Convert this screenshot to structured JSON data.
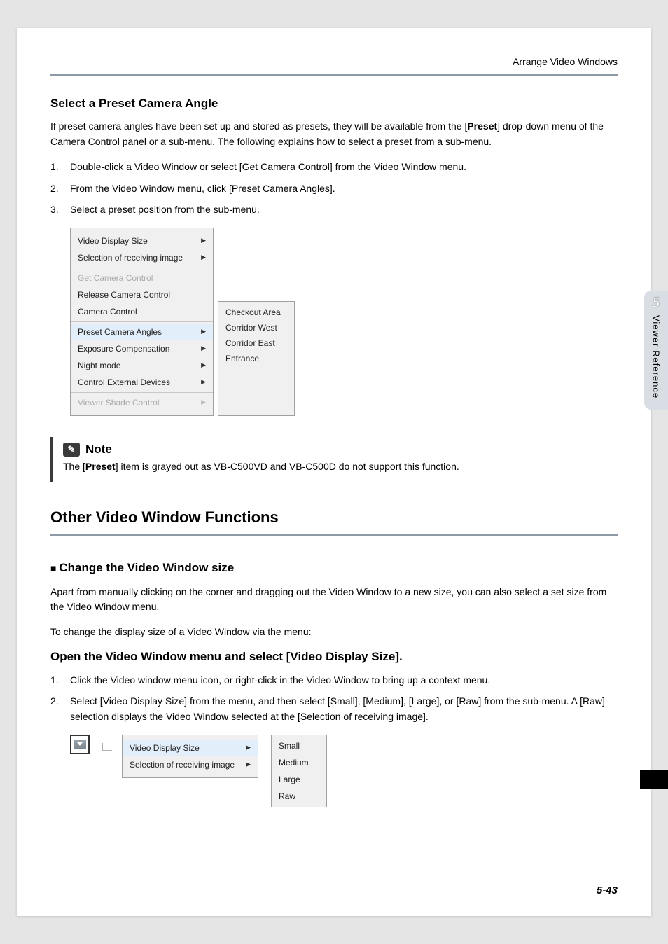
{
  "header_label": "Arrange Video Windows",
  "section1": {
    "title": "Select a Preset Camera Angle",
    "intro_pre": "If preset camera angles have been set up and stored as presets, they will be available from the [",
    "intro_bold": "Preset",
    "intro_post": "] drop-down menu of the Camera Control panel or a sub-menu. The following explains how to select a preset from a sub-menu.",
    "steps": [
      "Double-click a Video Window or select [Get Camera Control] from the Video Window menu.",
      "From the Video Window menu, click [Preset Camera Angles].",
      "Select a preset position from the sub-menu."
    ]
  },
  "menu1": {
    "group1": [
      "Video Display Size",
      "Selection of receiving image"
    ],
    "group2": [
      "Get Camera Control",
      "Release Camera Control",
      "Camera Control"
    ],
    "group3": [
      "Preset Camera Angles",
      "Exposure Compensation",
      "Night mode",
      "Control External Devices"
    ],
    "group4": [
      "Viewer Shade Control"
    ],
    "submenu": [
      "Checkout Area",
      "Corridor West",
      "Corridor East",
      "Entrance"
    ]
  },
  "note": {
    "label": "Note",
    "text_pre": "The [",
    "text_bold": "Preset",
    "text_post": "] item is grayed out as VB-C500VD and VB-C500D do not support this function."
  },
  "section2": {
    "title": "Other Video Window Functions",
    "sub_title": "Change the Video Window size",
    "para1": "Apart from manually clicking on the corner and dragging out the Video Window to a new size, you can also select a set size from the Video Window menu.",
    "para2": "To change the display size of a Video Window via the menu:",
    "sub3": "Open the Video Window menu and select [Video Display Size].",
    "steps": [
      "Click the Video window menu icon, or right-click in the Video Window to bring up a context menu.",
      "Select [Video Display Size] from the menu, and then select [Small], [Medium], [Large], or [Raw] from the sub-menu. A [Raw] selection displays the Video Window selected at the [Selection of receiving image]."
    ]
  },
  "menu2": {
    "group1": [
      "Video Display Size",
      "Selection of receiving image"
    ],
    "submenu": [
      "Small",
      "Medium",
      "Large",
      "Raw"
    ]
  },
  "side_tab": {
    "num": "5",
    "label": "Viewer Reference"
  },
  "page_num": "5-43"
}
